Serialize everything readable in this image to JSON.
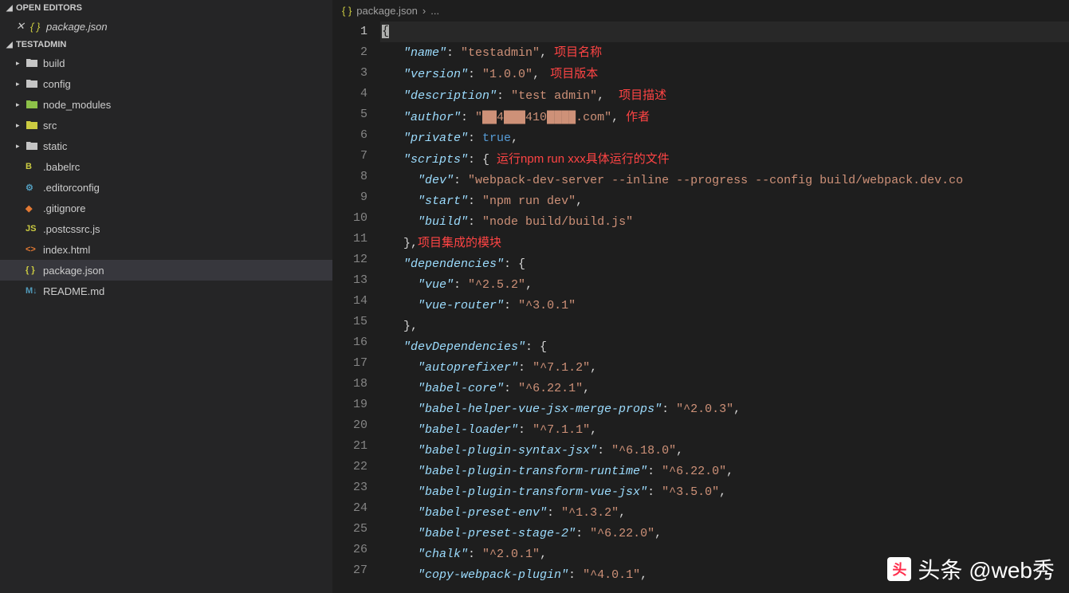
{
  "sidebar": {
    "open_editors_label": "OPEN EDITORS",
    "open_tab": "package.json",
    "project_label": "TESTADMIN",
    "tree": [
      {
        "type": "folder",
        "name": "build",
        "icon": "folder"
      },
      {
        "type": "folder",
        "name": "config",
        "icon": "folder"
      },
      {
        "type": "folder",
        "name": "node_modules",
        "icon": "folder-green"
      },
      {
        "type": "folder",
        "name": "src",
        "icon": "folder-yellow"
      },
      {
        "type": "folder",
        "name": "static",
        "icon": "folder"
      },
      {
        "type": "file",
        "name": ".babelrc",
        "icon": "babel"
      },
      {
        "type": "file",
        "name": ".editorconfig",
        "icon": "editorconfig"
      },
      {
        "type": "file",
        "name": ".gitignore",
        "icon": "git"
      },
      {
        "type": "file",
        "name": ".postcssrc.js",
        "icon": "js"
      },
      {
        "type": "file",
        "name": "index.html",
        "icon": "html"
      },
      {
        "type": "file",
        "name": "package.json",
        "icon": "braces",
        "selected": true
      },
      {
        "type": "file",
        "name": "README.md",
        "icon": "md"
      }
    ]
  },
  "breadcrumb": {
    "file": "package.json",
    "sep": "›",
    "more": "..."
  },
  "code": {
    "lines": [
      {
        "n": 1,
        "tokens": [
          [
            "curs",
            "{"
          ]
        ],
        "highlight": true
      },
      {
        "n": 2,
        "tokens": [
          [
            "punc",
            "   "
          ],
          [
            "key",
            "\"name\""
          ],
          [
            "punc",
            ": "
          ],
          [
            "str",
            "\"testadmin\""
          ],
          [
            "punc",
            ", "
          ],
          [
            "annot",
            "项目名称"
          ]
        ]
      },
      {
        "n": 3,
        "tokens": [
          [
            "punc",
            "   "
          ],
          [
            "key",
            "\"version\""
          ],
          [
            "punc",
            ": "
          ],
          [
            "str",
            "\"1.0.0\""
          ],
          [
            "punc",
            ", "
          ],
          [
            "annot",
            " 项目版本"
          ]
        ]
      },
      {
        "n": 4,
        "tokens": [
          [
            "punc",
            "   "
          ],
          [
            "key",
            "\"description\""
          ],
          [
            "punc",
            ": "
          ],
          [
            "str",
            "\"test admin\""
          ],
          [
            "punc",
            ",  "
          ],
          [
            "annot",
            "项目描述"
          ]
        ]
      },
      {
        "n": 5,
        "tokens": [
          [
            "punc",
            "   "
          ],
          [
            "key",
            "\"author\""
          ],
          [
            "punc",
            ": "
          ],
          [
            "str",
            "\"██4███410████.com\""
          ],
          [
            "punc",
            ", "
          ],
          [
            "annot",
            "作者"
          ]
        ]
      },
      {
        "n": 6,
        "tokens": [
          [
            "punc",
            "   "
          ],
          [
            "key",
            "\"private\""
          ],
          [
            "punc",
            ": "
          ],
          [
            "bool",
            "true"
          ],
          [
            "punc",
            ","
          ]
        ]
      },
      {
        "n": 7,
        "tokens": [
          [
            "punc",
            "   "
          ],
          [
            "key",
            "\"scripts\""
          ],
          [
            "punc",
            ": { "
          ],
          [
            "annot",
            "运行npm run xxx具体运行的文件"
          ]
        ]
      },
      {
        "n": 8,
        "tokens": [
          [
            "punc",
            "     "
          ],
          [
            "key",
            "\"dev\""
          ],
          [
            "punc",
            ": "
          ],
          [
            "str",
            "\"webpack-dev-server --inline --progress --config build/webpack.dev.co"
          ]
        ]
      },
      {
        "n": 9,
        "tokens": [
          [
            "punc",
            "     "
          ],
          [
            "key",
            "\"start\""
          ],
          [
            "punc",
            ": "
          ],
          [
            "str",
            "\"npm run dev\""
          ],
          [
            "punc",
            ","
          ]
        ]
      },
      {
        "n": 10,
        "tokens": [
          [
            "punc",
            "     "
          ],
          [
            "key",
            "\"build\""
          ],
          [
            "punc",
            ": "
          ],
          [
            "str",
            "\"node build/build.js\""
          ]
        ]
      },
      {
        "n": 11,
        "tokens": [
          [
            "punc",
            "   },"
          ],
          [
            "annot",
            "项目集成的模块"
          ]
        ]
      },
      {
        "n": 12,
        "tokens": [
          [
            "punc",
            "   "
          ],
          [
            "key",
            "\"dependencies\""
          ],
          [
            "punc",
            ": {"
          ]
        ]
      },
      {
        "n": 13,
        "tokens": [
          [
            "punc",
            "     "
          ],
          [
            "key",
            "\"vue\""
          ],
          [
            "punc",
            ": "
          ],
          [
            "str",
            "\"^2.5.2\""
          ],
          [
            "punc",
            ","
          ]
        ]
      },
      {
        "n": 14,
        "tokens": [
          [
            "punc",
            "     "
          ],
          [
            "key",
            "\"vue-router\""
          ],
          [
            "punc",
            ": "
          ],
          [
            "str",
            "\"^3.0.1\""
          ]
        ]
      },
      {
        "n": 15,
        "tokens": [
          [
            "punc",
            "   },"
          ]
        ]
      },
      {
        "n": 16,
        "tokens": [
          [
            "punc",
            "   "
          ],
          [
            "key",
            "\"devDependencies\""
          ],
          [
            "punc",
            ": {"
          ]
        ]
      },
      {
        "n": 17,
        "tokens": [
          [
            "punc",
            "     "
          ],
          [
            "key",
            "\"autoprefixer\""
          ],
          [
            "punc",
            ": "
          ],
          [
            "str",
            "\"^7.1.2\""
          ],
          [
            "punc",
            ","
          ]
        ]
      },
      {
        "n": 18,
        "tokens": [
          [
            "punc",
            "     "
          ],
          [
            "key",
            "\"babel-core\""
          ],
          [
            "punc",
            ": "
          ],
          [
            "str",
            "\"^6.22.1\""
          ],
          [
            "punc",
            ","
          ]
        ]
      },
      {
        "n": 19,
        "tokens": [
          [
            "punc",
            "     "
          ],
          [
            "key",
            "\"babel-helper-vue-jsx-merge-props\""
          ],
          [
            "punc",
            ": "
          ],
          [
            "str",
            "\"^2.0.3\""
          ],
          [
            "punc",
            ","
          ]
        ]
      },
      {
        "n": 20,
        "tokens": [
          [
            "punc",
            "     "
          ],
          [
            "key",
            "\"babel-loader\""
          ],
          [
            "punc",
            ": "
          ],
          [
            "str",
            "\"^7.1.1\""
          ],
          [
            "punc",
            ","
          ]
        ]
      },
      {
        "n": 21,
        "tokens": [
          [
            "punc",
            "     "
          ],
          [
            "key",
            "\"babel-plugin-syntax-jsx\""
          ],
          [
            "punc",
            ": "
          ],
          [
            "str",
            "\"^6.18.0\""
          ],
          [
            "punc",
            ","
          ]
        ]
      },
      {
        "n": 22,
        "tokens": [
          [
            "punc",
            "     "
          ],
          [
            "key",
            "\"babel-plugin-transform-runtime\""
          ],
          [
            "punc",
            ": "
          ],
          [
            "str",
            "\"^6.22.0\""
          ],
          [
            "punc",
            ","
          ]
        ]
      },
      {
        "n": 23,
        "tokens": [
          [
            "punc",
            "     "
          ],
          [
            "key",
            "\"babel-plugin-transform-vue-jsx\""
          ],
          [
            "punc",
            ": "
          ],
          [
            "str",
            "\"^3.5.0\""
          ],
          [
            "punc",
            ","
          ]
        ]
      },
      {
        "n": 24,
        "tokens": [
          [
            "punc",
            "     "
          ],
          [
            "key",
            "\"babel-preset-env\""
          ],
          [
            "punc",
            ": "
          ],
          [
            "str",
            "\"^1.3.2\""
          ],
          [
            "punc",
            ","
          ]
        ]
      },
      {
        "n": 25,
        "tokens": [
          [
            "punc",
            "     "
          ],
          [
            "key",
            "\"babel-preset-stage-2\""
          ],
          [
            "punc",
            ": "
          ],
          [
            "str",
            "\"^6.22.0\""
          ],
          [
            "punc",
            ","
          ]
        ]
      },
      {
        "n": 26,
        "tokens": [
          [
            "punc",
            "     "
          ],
          [
            "key",
            "\"chalk\""
          ],
          [
            "punc",
            ": "
          ],
          [
            "str",
            "\"^2.0.1\""
          ],
          [
            "punc",
            ","
          ]
        ]
      },
      {
        "n": 27,
        "tokens": [
          [
            "punc",
            "     "
          ],
          [
            "key",
            "\"copy-webpack-plugin\""
          ],
          [
            "punc",
            ": "
          ],
          [
            "str",
            "\"^4.0.1\""
          ],
          [
            "punc",
            ","
          ]
        ]
      }
    ]
  },
  "watermark": "头条 @web秀"
}
